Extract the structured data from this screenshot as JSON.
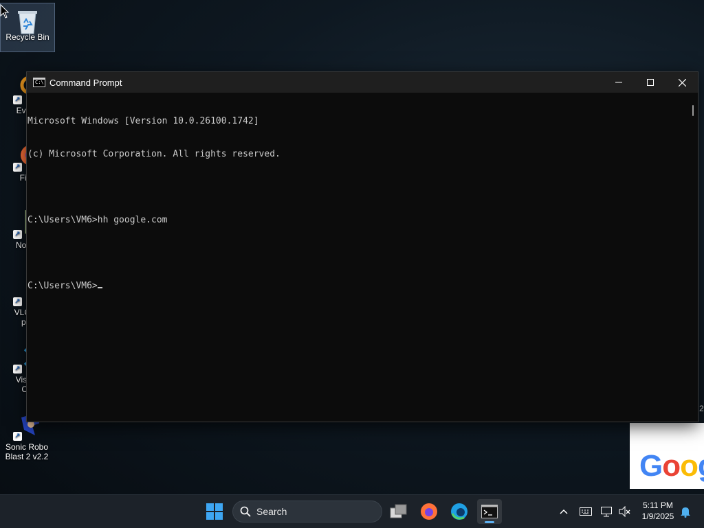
{
  "desktop": {
    "icons": [
      {
        "label": "Recycle Bin"
      },
      {
        "label": "Every"
      },
      {
        "label": "Fire"
      },
      {
        "label": "Notep"
      },
      {
        "label_line1": "VLC m",
        "label_line2": "pla"
      },
      {
        "label_line1": "Visual",
        "label_line2": "Co"
      },
      {
        "label_line1": "Sonic Robo",
        "label_line2": "Blast 2 v2.2"
      }
    ],
    "edge_glyph": "2"
  },
  "cmd_window": {
    "title": "Command Prompt",
    "icon_text": "C:\\",
    "minimize": "—",
    "maximize": "☐",
    "close": "✕",
    "lines": [
      "Microsoft Windows [Version 10.0.26100.1742]",
      "(c) Microsoft Corporation. All rights reserved.",
      "",
      "C:\\Users\\VM6>hh google.com",
      "",
      "C:\\Users\\VM6>"
    ]
  },
  "google_preview": {
    "text": "Goog",
    "colors": [
      "#4285F4",
      "#EA4335",
      "#FBBC05",
      "#4285F4"
    ]
  },
  "taskbar": {
    "search_placeholder": "Search",
    "apps": [
      "start-icon",
      "task-view-icon",
      "firefox-icon",
      "edge-icon",
      "terminal-icon"
    ],
    "clock": {
      "time": "5:11 PM",
      "date": "1/9/2025"
    },
    "tray_overflow": "^"
  },
  "colors": {
    "taskbar_bg": "#1c2229",
    "terminal_bg": "#0c0c0c",
    "accent": "#5fb2f2"
  }
}
